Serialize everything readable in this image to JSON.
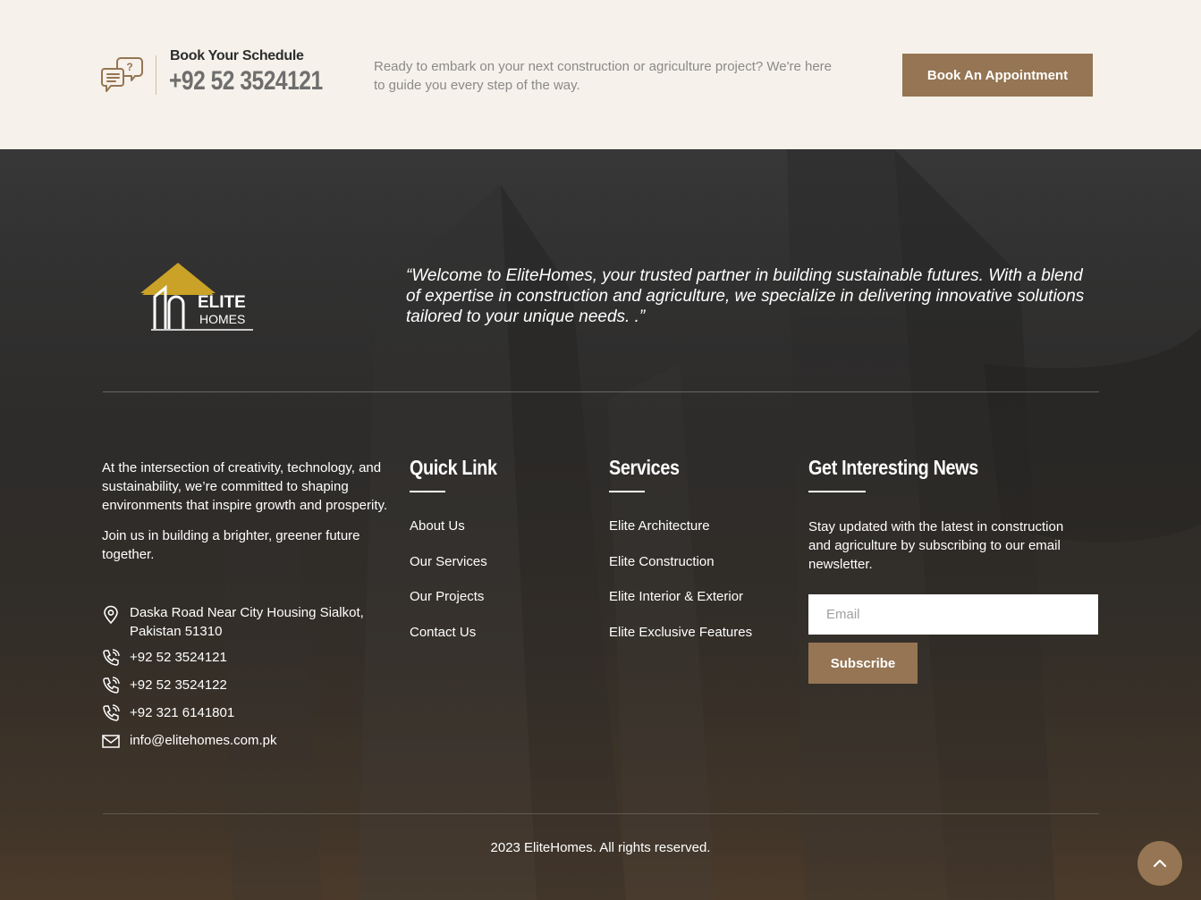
{
  "schedule": {
    "title": "Book Your Schedule",
    "phone": "+92 52 3524121",
    "text": "Ready to embark on your next construction or agriculture project? We're here to guide you every step of the way.",
    "button": "Book An Appointment"
  },
  "brand": {
    "logo_word1": "ELITE",
    "logo_word2": "HOMES"
  },
  "quote": "“Welcome to EliteHomes, your trusted partner in building sustainable futures. With a blend of expertise in construction and agriculture, we specialize in delivering innovative solutions tailored to your unique needs. .”",
  "about": {
    "p1": "At the intersection of creativity, technology, and sustainability, we’re committed to shaping environments that inspire growth and prosperity.",
    "p2": "Join us in building a brighter, greener future together."
  },
  "contact": {
    "address": "Daska Road Near City Housing Sialkot, Pakistan 51310",
    "phone1": "+92 52 3524121",
    "phone2": "+92 52 3524122",
    "phone3": "+92 321 6141801",
    "email": "info@elitehomes.com.pk"
  },
  "quick_links": {
    "title": "Quick Link",
    "items": [
      "About Us",
      "Our Services",
      "Our Projects",
      "Contact Us"
    ]
  },
  "services": {
    "title": "Services",
    "items": [
      "Elite Architecture",
      "Elite Construction",
      "Elite Interior & Exterior",
      "Elite Exclusive Features"
    ]
  },
  "newsletter": {
    "title": "Get Interesting News",
    "text": "Stay updated with the latest in construction and agriculture by subscribing to our email newsletter.",
    "email_placeholder": "Email",
    "subscribe": "Subscribe"
  },
  "copyright": "2023 EliteHomes. All rights reserved.",
  "colors": {
    "accent": "#957553",
    "logo_gold": "#c9a227",
    "strip_bg": "#f6f1ea",
    "footer_bg": "#2e2e2e"
  },
  "icons": {
    "schedule": "chat-question-icon",
    "address": "location-pin-icon",
    "phone": "phone-icon",
    "email": "envelope-icon",
    "back_to_top": "chevron-up-icon"
  }
}
